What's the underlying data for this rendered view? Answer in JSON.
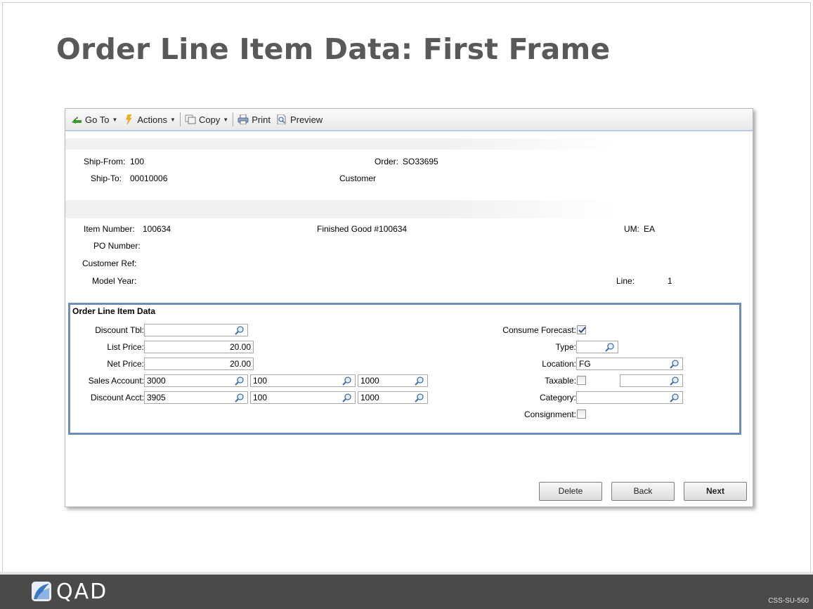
{
  "slide": {
    "title": "Order Line Item Data: First Frame",
    "code": "CSS-SU-560",
    "logo_text": "QAD"
  },
  "toolbar": {
    "goto_label": "Go To",
    "actions_label": "Actions",
    "copy_label": "Copy",
    "print_label": "Print",
    "preview_label": "Preview"
  },
  "header": {
    "ship_from_label": "Ship-From:",
    "ship_from_value": "100",
    "order_label": "Order:",
    "order_value": "SO33695",
    "ship_to_label": "Ship-To:",
    "ship_to_value": "00010006",
    "customer_label": "Customer"
  },
  "item": {
    "item_number_label": "Item Number:",
    "item_number_value": "100634",
    "description": "Finished Good #100634",
    "um_label": "UM:",
    "um_value": "EA",
    "po_number_label": "PO Number:",
    "customer_ref_label": "Customer Ref:",
    "model_year_label": "Model Year:",
    "line_label": "Line:",
    "line_value": "1"
  },
  "group": {
    "title": "Order Line Item Data",
    "discount_tbl_label": "Discount Tbl:",
    "discount_tbl_value": "",
    "list_price_label": "List Price:",
    "list_price_value": "20.00",
    "net_price_label": "Net Price:",
    "net_price_value": "20.00",
    "sales_account_label": "Sales Account:",
    "sales_account_value": "3000",
    "sales_sub_value": "100",
    "sales_cc_value": "1000",
    "discount_acct_label": "Discount Acct:",
    "discount_acct_value": "3905",
    "discount_sub_value": "100",
    "discount_cc_value": "1000",
    "consume_forecast_label": "Consume Forecast:",
    "consume_forecast_checked": true,
    "type_label": "Type:",
    "type_value": "",
    "location_label": "Location:",
    "location_value": "FG",
    "taxable_label": "Taxable:",
    "taxable_checked": false,
    "tax_code_value": "",
    "category_label": "Category:",
    "category_value": "",
    "consignment_label": "Consignment:",
    "consignment_checked": false
  },
  "buttons": {
    "delete_label": "Delete",
    "back_label": "Back",
    "next_label": "Next"
  },
  "colors": {
    "group_border": "#6c8ebf",
    "title_text": "#595959",
    "footer_dark": "#4a4a4a"
  }
}
